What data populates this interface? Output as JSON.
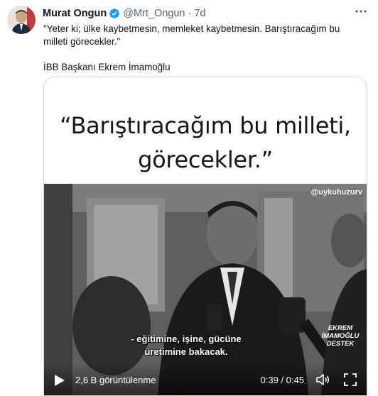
{
  "tweet": {
    "author_name": "Murat Ongun",
    "handle": "@Mrt_Ongun",
    "separator": "·",
    "time": "7d",
    "text_line1": "\"Yeter ki; ülke kaybetmesin, memleket kaybetmesin. Barıştıracağım bu milleti görecekler.\"",
    "text_line2": "İBB Başkanı Ekrem İmamoğlu"
  },
  "video": {
    "quote_line1": "“Barıştıracağım bu milleti,",
    "quote_line2": "görecekler.”",
    "watermark": "@uykuhuzurv",
    "subtitle_line1": "- eğitimine, işine, gücüne",
    "subtitle_line2": "üretimine bakacak.",
    "support_line1": "EKREM",
    "support_line2": "İMAMOĞLU",
    "support_line3": "DESTEK",
    "views": "2,6 B görüntülenme",
    "timer": "0:39 / 0:45"
  },
  "colors": {
    "text": "#0f1419",
    "secondary": "#536471",
    "verified": "#1d9bf0"
  },
  "icons": [
    "verified-badge-icon",
    "more-icon",
    "play-icon",
    "volume-icon",
    "fullscreen-icon"
  ]
}
